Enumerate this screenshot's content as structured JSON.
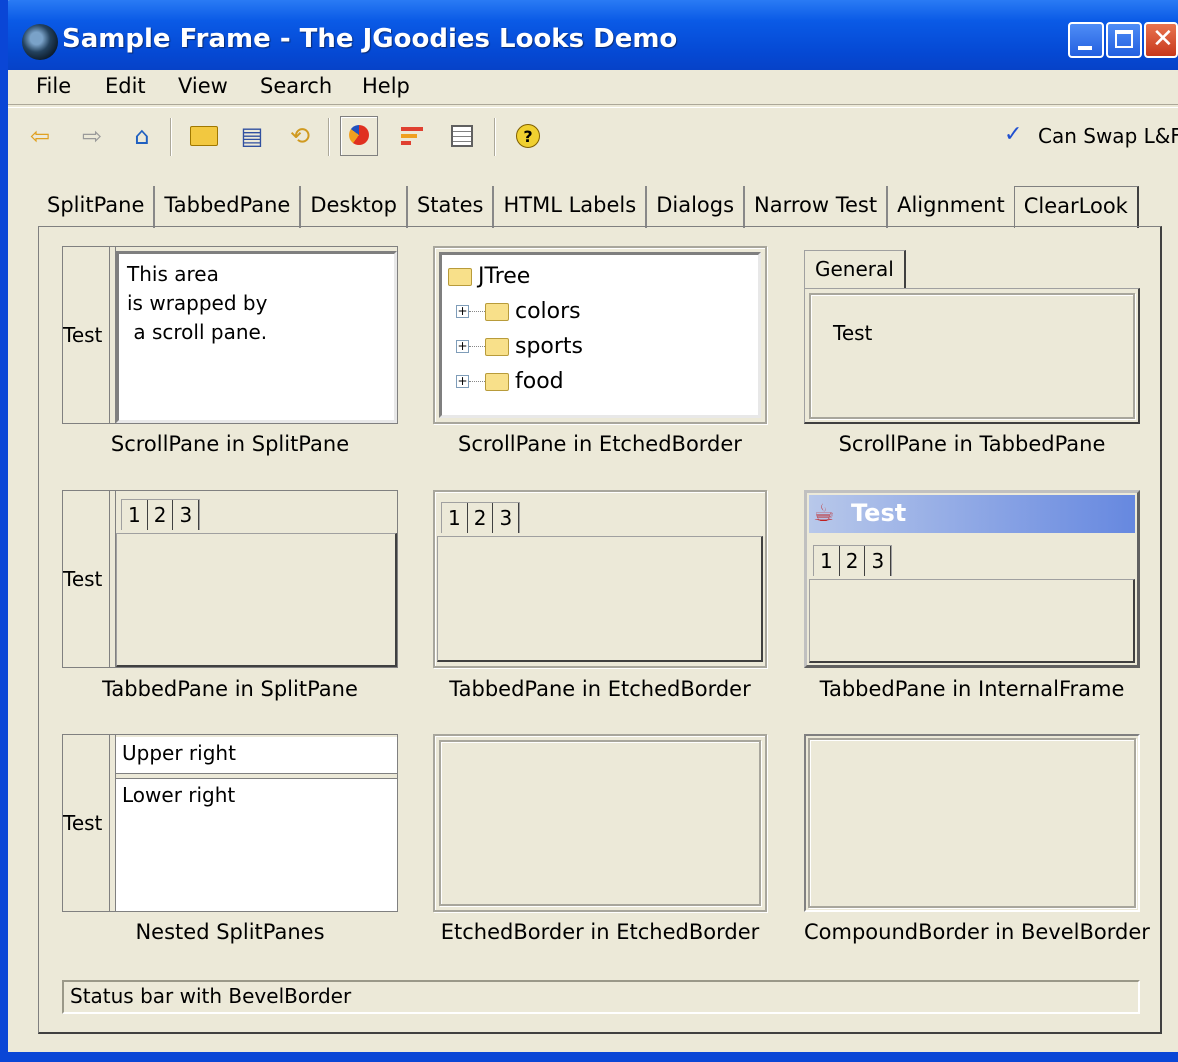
{
  "window": {
    "title": "Sample Frame - The JGoodies Looks Demo",
    "title_color": "#0a5ae6"
  },
  "menu": [
    "File",
    "Edit",
    "View",
    "Search",
    "Help"
  ],
  "toolbar": {
    "icons": [
      "back-arrow-icon",
      "forward-arrow-icon",
      "home-icon",
      "open-folder-icon",
      "print-icon",
      "refresh-icon",
      "pie-chart-icon",
      "bar-chart-icon",
      "table-icon",
      "help-icon"
    ],
    "swap_check": "✓",
    "swap_label": "Can Swap L&F"
  },
  "tabs": [
    "SplitPane",
    "TabbedPane",
    "Desktop",
    "States",
    "HTML Labels",
    "Dialogs",
    "Narrow Test",
    "Alignment",
    "ClearLook"
  ],
  "selected_tab": "ClearLook",
  "cells": {
    "split_scroll": {
      "left_label": "Test",
      "text_lines": [
        "This area",
        "is wrapped by",
        " a scroll pane."
      ],
      "caption": "ScrollPane in SplitPane"
    },
    "etched_tree": {
      "root": "JTree",
      "children": [
        "colors",
        "sports",
        "food"
      ],
      "caption": "ScrollPane in EtchedBorder"
    },
    "tabbed_scroll": {
      "tab": "General",
      "content": "Test",
      "caption": "ScrollPane in TabbedPane"
    },
    "split_tabbed": {
      "left_label": "Test",
      "tabs": [
        "1",
        "2",
        "3"
      ],
      "caption": "TabbedPane in SplitPane"
    },
    "etched_tabbed": {
      "tabs": [
        "1",
        "2",
        "3"
      ],
      "caption": "TabbedPane in EtchedBorder"
    },
    "internal_frame": {
      "title": "Test",
      "tabs": [
        "1",
        "2",
        "3"
      ],
      "caption": "TabbedPane in InternalFrame"
    },
    "nested_split": {
      "left_label": "Test",
      "upper": "Upper right",
      "lower": "Lower right",
      "caption": "Nested SplitPanes"
    },
    "etched_etched": {
      "caption": "EtchedBorder in EtchedBorder"
    },
    "compound_bevel": {
      "caption": "CompoundBorder in BevelBorder"
    }
  },
  "status_bar": "Status bar with BevelBorder"
}
